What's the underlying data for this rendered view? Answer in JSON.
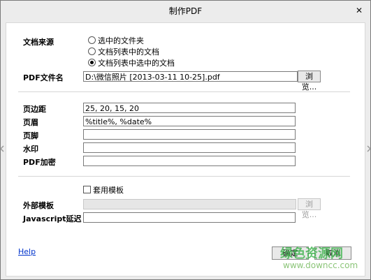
{
  "window": {
    "title": "制作PDF",
    "close_symbol": "✕"
  },
  "source": {
    "label": "文档来源",
    "options": [
      {
        "label": "选中的文件夹",
        "checked": false
      },
      {
        "label": "文档列表中的文档",
        "checked": false
      },
      {
        "label": "文档列表中选中的文档",
        "checked": true
      }
    ]
  },
  "pdf_file": {
    "label": "PDF文件名",
    "value": "D:\\微信照片 [2013-03-11 10-25].pdf",
    "browse_label": "浏览..."
  },
  "page_margin": {
    "label": "页边距",
    "value": "25, 20, 15, 20"
  },
  "header_field": {
    "label": "页眉",
    "value": "%title%, %date%"
  },
  "footer_field": {
    "label": "页脚",
    "value": ""
  },
  "watermark": {
    "label": "水印",
    "value": ""
  },
  "encryption": {
    "label": "PDF加密",
    "value": ""
  },
  "template": {
    "checkbox_label": "套用模板",
    "checked": false,
    "external_label": "外部模板",
    "external_value": "",
    "browse_label": "浏览...",
    "javascript_label": "Javascript延迟",
    "javascript_value": ""
  },
  "footer": {
    "help_label": "Help",
    "ok_label": "确定",
    "cancel_label": "取消"
  },
  "watermark_overlay": {
    "line1": "绿色资源网",
    "line2": "www.downcc.com"
  }
}
